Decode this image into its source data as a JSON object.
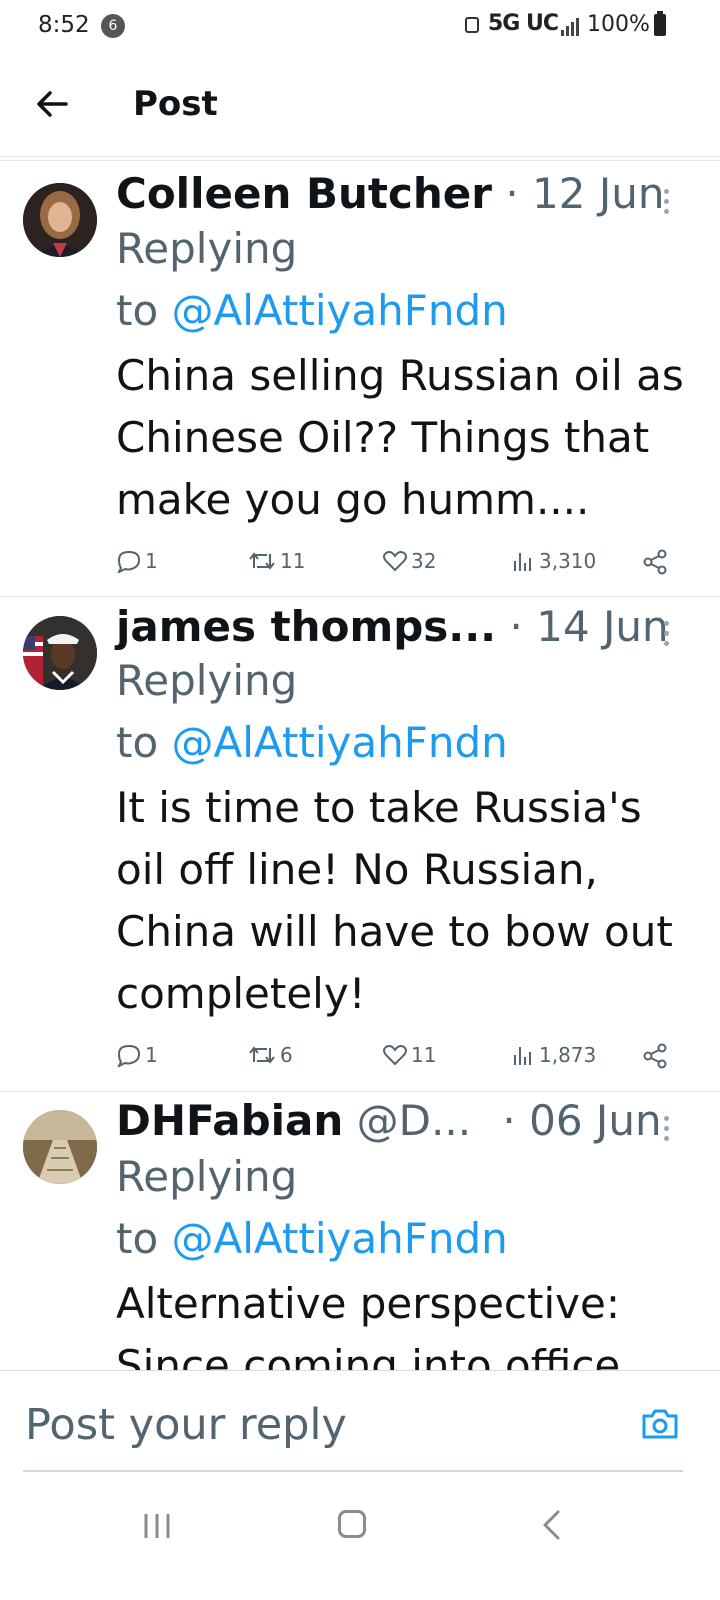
{
  "status_bar": {
    "time": "8:52",
    "notification_count": "6",
    "network": "5G UC",
    "battery": "100%"
  },
  "header": {
    "title": "Post"
  },
  "tweets": [
    {
      "name": "Colleen Butcher",
      "handle": "",
      "date": "12 Jun",
      "replying_prefix": "Replying",
      "replying_to_word": "to",
      "replying_to": "@AlAttiyahFndn",
      "body": "China selling Russian oil as Chinese Oil??  Things that make you go humm....",
      "replies": "1",
      "reposts": "11",
      "likes": "32",
      "views": "3,310"
    },
    {
      "name": "james thomps...",
      "handle": "",
      "date": "14 Jun",
      "replying_prefix": "Replying",
      "replying_to_word": "to",
      "replying_to": "@AlAttiyahFndn",
      "body": "It is time to take Russia's oil off line! No Russian, China will have to bow out completely!",
      "replies": "1",
      "reposts": "6",
      "likes": "11",
      "views": "1,873"
    },
    {
      "name": "DHFabian",
      "handle": "@D...",
      "date": "06 Jun",
      "replying_prefix": "Replying",
      "replying_to_word": "to",
      "replying_to": "@AlAttiyahFndn",
      "body": "Alternative perspective: Since coming into office"
    }
  ],
  "composer": {
    "placeholder": "Post your reply"
  },
  "colors": {
    "accent": "#1d9bf0",
    "text": "#0f1419",
    "secondary": "#536471"
  }
}
